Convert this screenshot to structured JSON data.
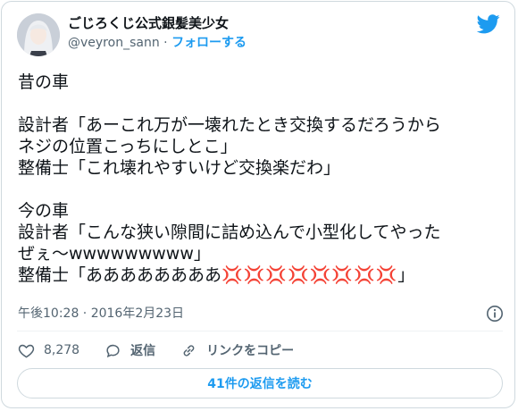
{
  "author": {
    "display_name": "ごじろくじ公式銀髪美少女",
    "handle": "@veyron_sann",
    "separator": "·",
    "follow_label": "フォローする"
  },
  "tweet": {
    "line1": "昔の車",
    "line2": "設計者「あーこれ万が一壊れたとき交換するだろうから",
    "line3": "ネジの位置こっちにしとこ」",
    "line4": "整備士「これ壊れやすいけど交換楽だわ」",
    "line5": "今の車",
    "line6": "設計者「こんな狭い隙間に詰め込んで小型化してやった",
    "line7": "ぜぇ〜wwwwwwwww」",
    "line8_text": "整備士「ああああああああ",
    "line8_emoji": "💢💢💢💢💢💢💢💢",
    "line8_end": "」"
  },
  "meta": {
    "timestamp": "午後10:28 · 2016年2月23日"
  },
  "actions": {
    "like_count": "8,278",
    "reply_label": "返信",
    "copy_link_label": "リンクをコピー"
  },
  "read_replies_label": "41件の返信を読む",
  "colors": {
    "accent": "#1d9bf0",
    "anger": "#e0245e",
    "muted": "#536471"
  },
  "icons": [
    "twitter-bird-icon",
    "info-icon",
    "heart-icon",
    "reply-icon",
    "link-icon"
  ]
}
